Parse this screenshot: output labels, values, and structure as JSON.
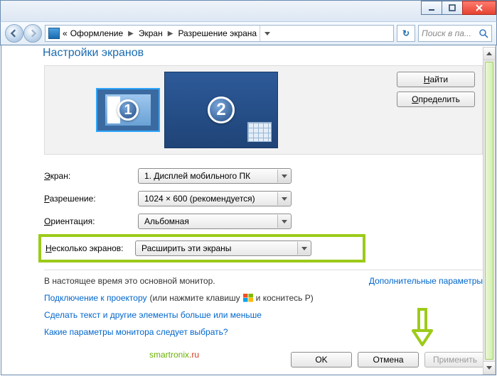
{
  "breadcrumb": {
    "sep_left": "«",
    "item1": "Оформление",
    "item2": "Экран",
    "item3": "Разрешение экрана"
  },
  "search": {
    "placeholder": "Поиск в па..."
  },
  "page_title": "Настройки экранов",
  "preview": {
    "mon1_num": "1",
    "mon2_num": "2",
    "find_btn": "Найти",
    "identify_btn": "Определить"
  },
  "labels": {
    "screen": "Экран:",
    "resolution": "Разрешение:",
    "orientation": "Ориентация:",
    "multiple": "Несколько экранов:"
  },
  "values": {
    "screen": "1. Дисплей мобильного ПК",
    "resolution": "1024 × 600 (рекомендуется)",
    "orientation": "Альбомная",
    "multiple": "Расширить эти экраны"
  },
  "note_main": "В настоящее время это основной монитор.",
  "note_link": "Дополнительные параметры",
  "projector": {
    "link": "Подключение к проектору",
    "rest1": "(или нажмите клавишу",
    "rest2": "и коснитесь P)"
  },
  "link_textsize": "Сделать текст и другие элементы больше или меньше",
  "link_which": "Какие параметры монитора следует выбрать?",
  "buttons": {
    "ok": "OK",
    "cancel": "Отмена",
    "apply": "Применить"
  },
  "watermark": {
    "part1": "smartronix",
    "part2": ".ru"
  }
}
